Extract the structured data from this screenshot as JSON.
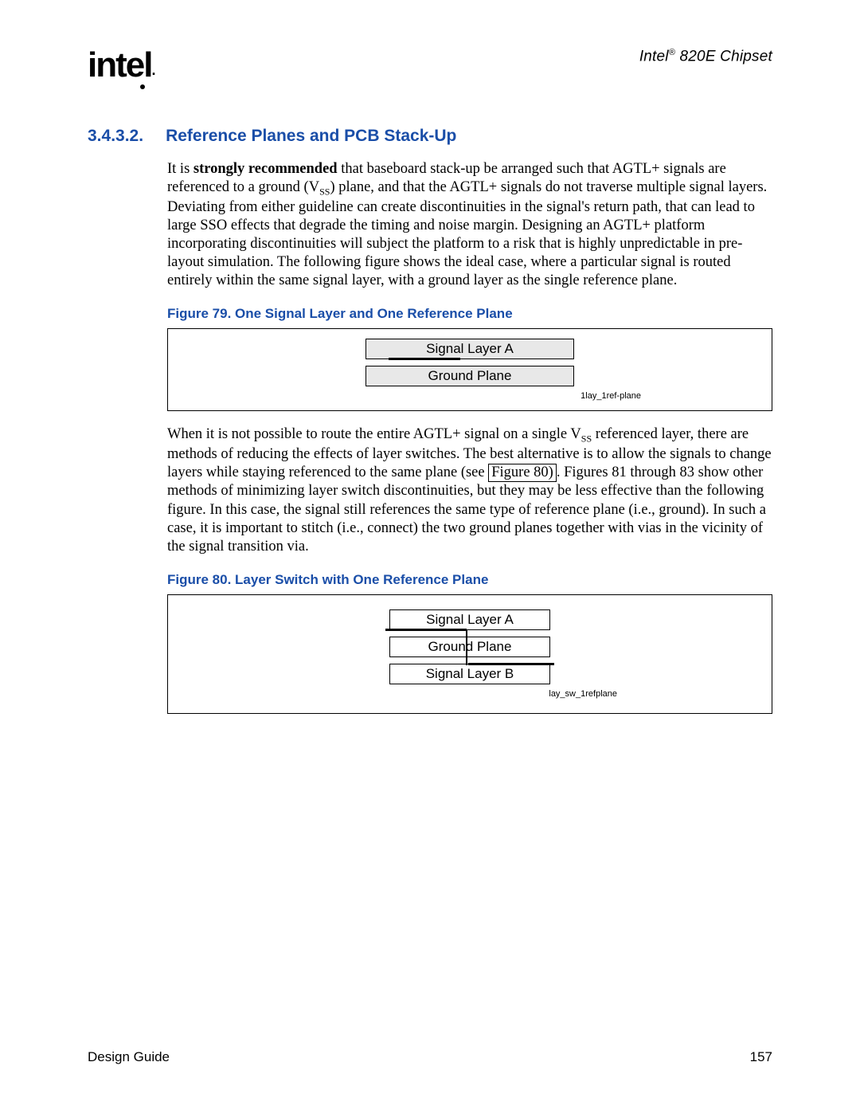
{
  "header": {
    "product_prefix": "Intel",
    "product_suffix": " 820E Chipset",
    "logo_text": "intel"
  },
  "section": {
    "number": "3.4.3.2.",
    "title": "Reference Planes and PCB Stack-Up"
  },
  "para1_lead": "It is ",
  "para1_strong": "strongly recommended",
  "para1_rest_a": " that baseboard stack-up be arranged such that AGTL+ signals are referenced to a ground (V",
  "para1_sub1": "SS",
  "para1_rest_b": ") plane, and that the AGTL+ signals do not traverse multiple signal layers. Deviating from either guideline can create discontinuities in the signal's return path, that can lead to large SSO effects that degrade the timing and noise margin. Designing an AGTL+ platform incorporating discontinuities will subject the platform to a risk that is highly unpredictable in pre-layout simulation. The following figure shows the ideal case, where a particular signal is routed entirely within the same signal layer, with a ground layer as the single reference plane.",
  "fig79": {
    "caption": "Figure 79. One Signal Layer and One Reference Plane",
    "layer_a": "Signal Layer A",
    "ground": "Ground Plane",
    "tag": "1lay_1ref-plane"
  },
  "para2_a": "When it is not possible to route the entire AGTL+ signal on a single V",
  "para2_sub": "SS",
  "para2_b": " referenced layer, there are methods of reducing the effects of layer switches. The best alternative is to allow the signals to change layers while staying referenced to the same plane (see ",
  "para2_link": "Figure 80)",
  "para2_c": ". Figures 81 through 83 show other methods of minimizing layer switch discontinuities, but they may be less effective than the following figure. In this case, the signal still references the same type of reference plane (i.e., ground). In such a case, it is important to stitch (i.e., connect) the two ground planes together with vias in the vicinity of the signal transition via.",
  "fig80": {
    "caption": "Figure 80. Layer Switch with One Reference Plane",
    "layer_a": "Signal Layer A",
    "ground": "Ground Plane",
    "layer_b": "Signal Layer B",
    "tag": "lay_sw_1refplane"
  },
  "footer": {
    "left": "Design Guide",
    "right": "157"
  }
}
